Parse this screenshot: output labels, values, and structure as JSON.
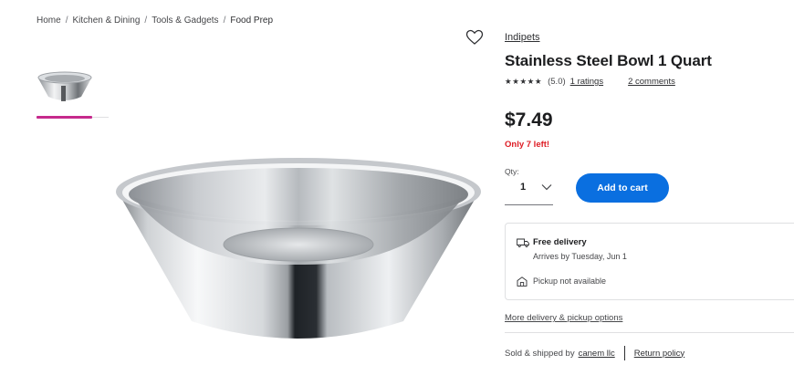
{
  "breadcrumb": {
    "items": [
      "Home",
      "Kitchen & Dining",
      "Tools & Gadgets"
    ],
    "current": "Food Prep",
    "separator": "/"
  },
  "product": {
    "brand": "Indipets",
    "title": "Stainless Steel Bowl 1 Quart",
    "stars": "★★★★★",
    "rating_score": "(5.0)",
    "ratings_link": "1 ratings",
    "comments_link": "2 comments",
    "price": "$7.49",
    "stock_message": "Only 7 left!"
  },
  "purchase": {
    "qty_label": "Qty:",
    "qty_value": "1",
    "add_to_cart_label": "Add to cart"
  },
  "delivery": {
    "title": "Free delivery",
    "subtitle": "Arrives by Tuesday, Jun 1",
    "pickup": "Pickup not available",
    "more_options_link": "More delivery & pickup options"
  },
  "seller": {
    "sold_by_label": "Sold & shipped by",
    "seller_name": "canem llc",
    "return_policy_link": "Return policy"
  },
  "colors": {
    "accent_blue": "#0a6fe0",
    "stock_red": "#de1c24",
    "thumb_highlight": "#c62a8c"
  },
  "icons": [
    "heart-icon",
    "chevron-down-icon",
    "truck-icon",
    "store-icon"
  ]
}
